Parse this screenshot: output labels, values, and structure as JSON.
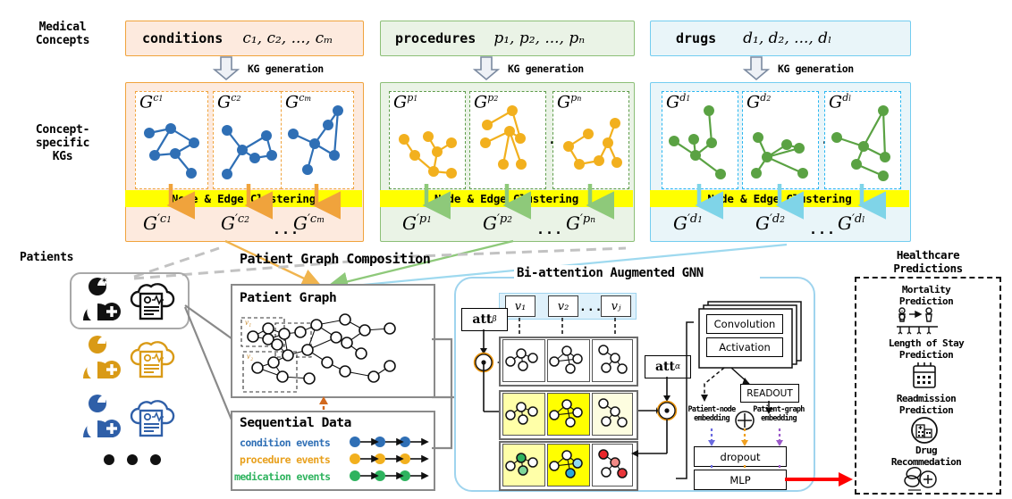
{
  "sidebar_labels": {
    "medical_concepts": "Medical\nConcepts",
    "concept_kgs": "Concept-\nspecific\nKGs",
    "patients": "Patients"
  },
  "concepts": [
    {
      "name": "conditions",
      "symbols": "c₁, c₂, ..., cₘ",
      "color": "#f0a33c",
      "fill": "#fdeade",
      "kg_color": "#2f6fb5",
      "sub": [
        "G^{c_1}",
        "G^{c_2}",
        "G^{c_m}"
      ],
      "clustered": [
        "G'^{c_1}",
        "G'^{c_2}",
        "G'^{c_m}"
      ]
    },
    {
      "name": "procedures",
      "symbols": "p₁, p₂, ..., pₙ",
      "color": "#8cbf77",
      "fill": "#eaf3e6",
      "kg_color": "#f2b01e",
      "sub": [
        "G^{p_1}",
        "G^{p_2}",
        "G^{p_n}"
      ],
      "clustered": [
        "G'^{p_1}",
        "G'^{p_2}",
        "G'^{p_n}"
      ]
    },
    {
      "name": "drugs",
      "symbols": "d₁, d₂, ..., dₗ",
      "color": "#73cdf0",
      "fill": "#e9f5f9",
      "kg_color": "#5aa243",
      "sub": [
        "G^{d_1}",
        "G^{d_2}",
        "G^{d_l}"
      ],
      "clustered": [
        "G'^{d_1}",
        "G'^{d_2}",
        "G'^{d_l}"
      ]
    }
  ],
  "kg_generation_label": "KG generation",
  "clustering_label": "Node & Edge Clustering",
  "ellipsis": "...",
  "composition": {
    "title": "Patient Graph Composition",
    "patient_graph_title": "Patient Graph",
    "node_labels": [
      "v₁",
      "v₂",
      "vⱼ"
    ],
    "sequential_title": "Sequential Data",
    "sequences": [
      {
        "label": "condition events",
        "color": "#2f6fb5"
      },
      {
        "label": "procedure events",
        "color": "#f2b01e"
      },
      {
        "label": "medication events",
        "color": "#2eb35e"
      }
    ]
  },
  "gnn": {
    "title": "Bi-attention Augmented GNN",
    "v_boxes": [
      "v₁",
      "v₂",
      "vⱼ"
    ],
    "v_ellipsis": "...",
    "att_beta": "att",
    "att_beta_sub": "β",
    "att_alpha": "att",
    "att_alpha_sub": "α",
    "convolution": "Convolution",
    "activation": "Activation",
    "readout": "READOUT",
    "patient_node_embedding": "Patient-node\nembedding",
    "patient_graph_embedding": "Patient-graph\nembedding",
    "dropout": "dropout",
    "mlp": "MLP"
  },
  "predictions": {
    "title": "Healthcare\nPredictions",
    "items": [
      {
        "label": "Mortality\nPrediction",
        "icon": "mortality-icon"
      },
      {
        "label": "Length of Stay\nPrediction",
        "icon": "calendar-icon"
      },
      {
        "label": "Readmission\nPrediction",
        "icon": "hospital-icon"
      },
      {
        "label": "Drug\nRecommedation",
        "icon": "pills-icon"
      }
    ]
  },
  "colors": {
    "yellow_bar": "#ffff00",
    "orange": "#f0a33c",
    "green": "#8cbf77",
    "blue": "#73cdf0",
    "gray": "#8a8a8a",
    "red_arrow": "#ff0000",
    "highlight_yellow": "#ffff00",
    "highlight_pale": "#ffffa8",
    "highlight_faint": "#fdfde0"
  }
}
